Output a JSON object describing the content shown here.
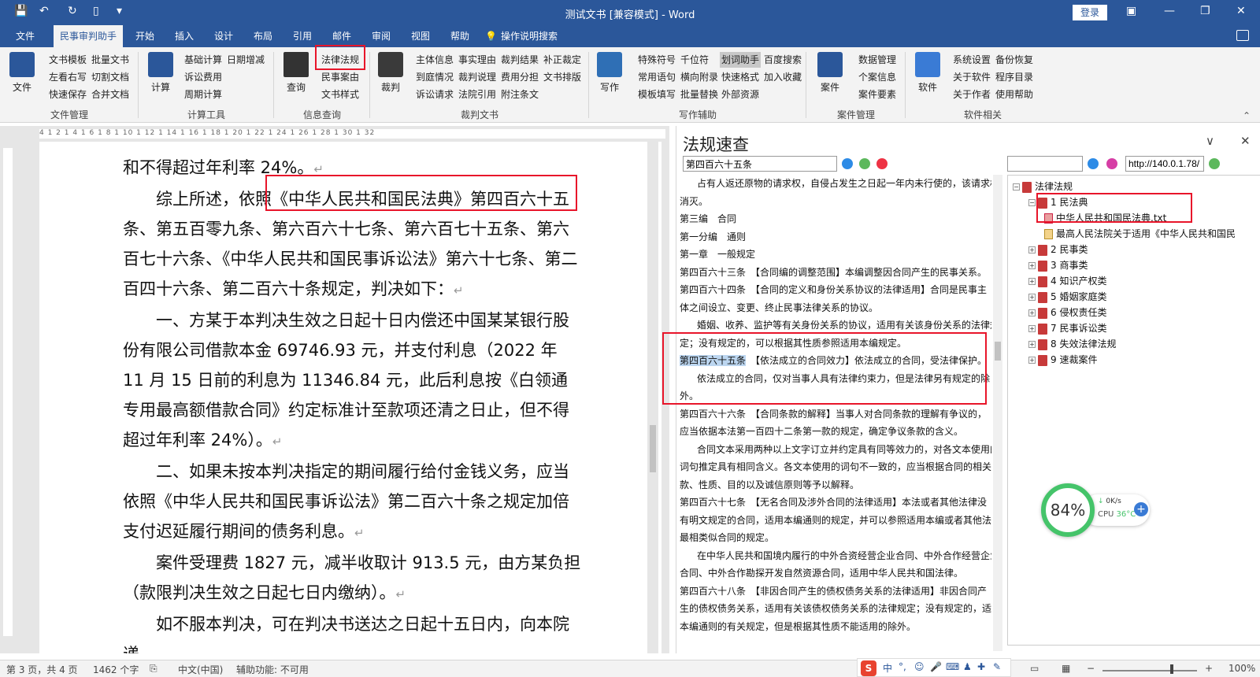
{
  "window": {
    "title": "测试文书 [兼容模式] - Word",
    "login_label": "登录",
    "quick_access": [
      "save-icon",
      "undo-icon",
      "redo-icon",
      "new-doc-icon",
      "customize-icon"
    ]
  },
  "tabs": [
    "文件",
    "民事审判助手",
    "开始",
    "插入",
    "设计",
    "布局",
    "引用",
    "邮件",
    "审阅",
    "视图",
    "帮助",
    "操作说明搜索"
  ],
  "ribbon": {
    "groups": [
      {
        "label": "文件管理",
        "big": "文件",
        "items": [
          "文书模板",
          "批量文书",
          "左看右写",
          "切割文档",
          "快速保存",
          "合并文档"
        ]
      },
      {
        "label": "计算工具",
        "big": "计算",
        "items": [
          "基础计算",
          "日期增减",
          "诉讼费用",
          "周期计算"
        ]
      },
      {
        "label": "信息查询",
        "big": "查询",
        "items": [
          "法律法规",
          "民事案由",
          "文书样式"
        ]
      },
      {
        "label": "裁判文书",
        "big": "裁判",
        "items": [
          "主体信息",
          "事实理由",
          "裁判结果",
          "补正裁定",
          "到庭情况",
          "裁判说理",
          "费用分担",
          "文书排版",
          "诉讼请求",
          "法院引用",
          "附注条文"
        ]
      },
      {
        "label": "写作辅助",
        "big": "写作",
        "items": [
          "特殊符号",
          "千位符",
          "划词助手",
          "百度搜索",
          "常用语句",
          "横向附录",
          "快速格式",
          "加入收藏",
          "模板填写",
          "批量替换",
          "外部资源"
        ]
      },
      {
        "label": "案件管理",
        "big": "案件",
        "items": [
          "数据管理",
          "个案信息",
          "案件要素"
        ]
      },
      {
        "label": "软件相关",
        "big": "软件",
        "items": [
          "系统设置",
          "备份恢复",
          "关于软件",
          "程序目录",
          "关于作者",
          "使用帮助"
        ]
      }
    ]
  },
  "document": {
    "paragraphs": [
      "和不得超过年利率 24%。",
      "综上所述，依照《中华人民共和国民法典》第四百六十五条、第五百零九条、第六百六十七条、第六百七十五条、第六百七十六条、《中华人民共和国民事诉讼法》第六十七条、第二百四十六条、第二百六十条规定，判决如下：",
      "一、方某于本判决生效之日起十日内偿还中国某某银行股份有限公司借款本金 69746.93 元，并支付利息（2022 年 11 月 15 日前的利息为 11346.84 元，此后利息按《白领通专用最高额借款合同》约定标准计至款项还清之日止，但不得超过年利率 24%）。",
      "二、如果未按本判决指定的期间履行给付金钱义务，应当依照《中华人民共和国民事诉讼法》第二百六十条之规定加倍支付迟延履行期间的债务利息。",
      "案件受理费 1827 元，减半收取计 913.5 元，由方某负担（款限判决生效之日起七日内缴纳）。",
      "如不服本判决，可在判决书送达之日起十五日内，向本院递"
    ],
    "ruler_ticks": "4 1 2 1 4 1 6 1 8 1 10 1 12 1 14 1 16 1 18 1 20 1 22 1 24 1 26 1 28 1 30 1 32"
  },
  "law_panel": {
    "title": "法规速查",
    "search_value": "第四百六十五条",
    "url_value": "http://140.0.1.78/",
    "url_input_value": "",
    "text_lines": [
      "占有人返还原物的请求权，自侵占发生之日起一年内未行使的，该请求权",
      "消灭。",
      "第三编　合同",
      "第一分编　通则",
      "第一章　一般规定",
      "第四百六十三条　【合同编的调整范围】本编调整因合同产生的民事关系。",
      "第四百六十四条　【合同的定义和身份关系协议的法律适用】合同是民事主",
      "体之间设立、变更、终止民事法律关系的协议。",
      "婚姻、收养、监护等有关身份关系的协议，适用有关该身份关系的法律规",
      "定；没有规定的，可以根据其性质参照适用本编规定。",
      "第四百六十五条",
      "【依法成立的合同效力】依法成立的合同，受法律保护。",
      "依法成立的合同，仅对当事人具有法律约束力，但是法律另有规定的除",
      "外。",
      "第四百六十六条　【合同条款的解释】当事人对合同条款的理解有争议的，",
      "应当依据本法第一百四十二条第一款的规定，确定争议条款的含义。",
      "合同文本采用两种以上文字订立并约定具有同等效力的，对各文本使用的",
      "词句推定具有相同含义。各文本使用的词句不一致的，应当根据合同的相关条",
      "款、性质、目的以及诚信原则等予以解释。",
      "第四百六十七条　【无名合同及涉外合同的法律适用】本法或者其他法律没",
      "有明文规定的合同，适用本编通则的规定，并可以参照适用本编或者其他法律",
      "最相类似合同的规定。",
      "在中华人民共和国境内履行的中外合资经营企业合同、中外合作经营企业",
      "合同、中外合作勘探开发自然资源合同，适用中华人民共和国法律。",
      "第四百六十八条　【非因合同产生的债权债务关系的法律适用】非因合同产",
      "生的债权债务关系，适用有关该债权债务关系的法律规定；没有规定的，适用",
      "本编通则的有关规定，但是根据其性质不能适用的除外。"
    ],
    "tree": {
      "root": "法律法规",
      "items": [
        "1 民法典",
        "中华人民共和国民法典.txt",
        "最高人民法院关于适用《中华人民共和国民",
        "2 民事类",
        "3 商事类",
        "4 知识产权类",
        "5 婚姻家庭类",
        "6 侵权责任类",
        "7 民事诉讼类",
        "8 失效法律法规",
        "9 速裁案件"
      ]
    }
  },
  "cpu_widget": {
    "percent": "84%",
    "speed": "0K/s",
    "label": "CPU",
    "temp": "36°C"
  },
  "status": {
    "page": "第 3 页，共 4 页",
    "words": "1462 个字",
    "lang": "中文(中国)",
    "accessibility": "辅助功能: 不可用",
    "zoom": "100%",
    "ime": "中"
  },
  "colors": {
    "brand": "#2b579a",
    "highlight_box": "#e8152a",
    "selection": "#bcd6f0"
  }
}
